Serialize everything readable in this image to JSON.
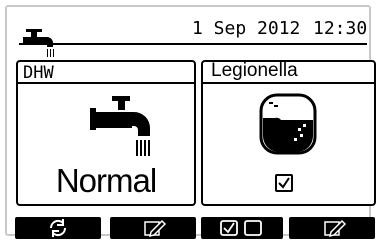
{
  "header": {
    "date": "1 Sep 2012",
    "time": "12:30",
    "status_icon": "hot-water-tap-icon"
  },
  "dhw_panel": {
    "title": "DHW",
    "icon": "hot-water-tap-icon",
    "mode": "Normal"
  },
  "legionella_panel": {
    "title": "Legionella",
    "icon": "water-tank-icon",
    "enabled": true
  },
  "function_buttons": [
    {
      "icon": "refresh-icon"
    },
    {
      "icon": "edit-icon"
    },
    {
      "icon": "checkbox-toggle-icon"
    },
    {
      "icon": "edit-icon"
    }
  ]
}
